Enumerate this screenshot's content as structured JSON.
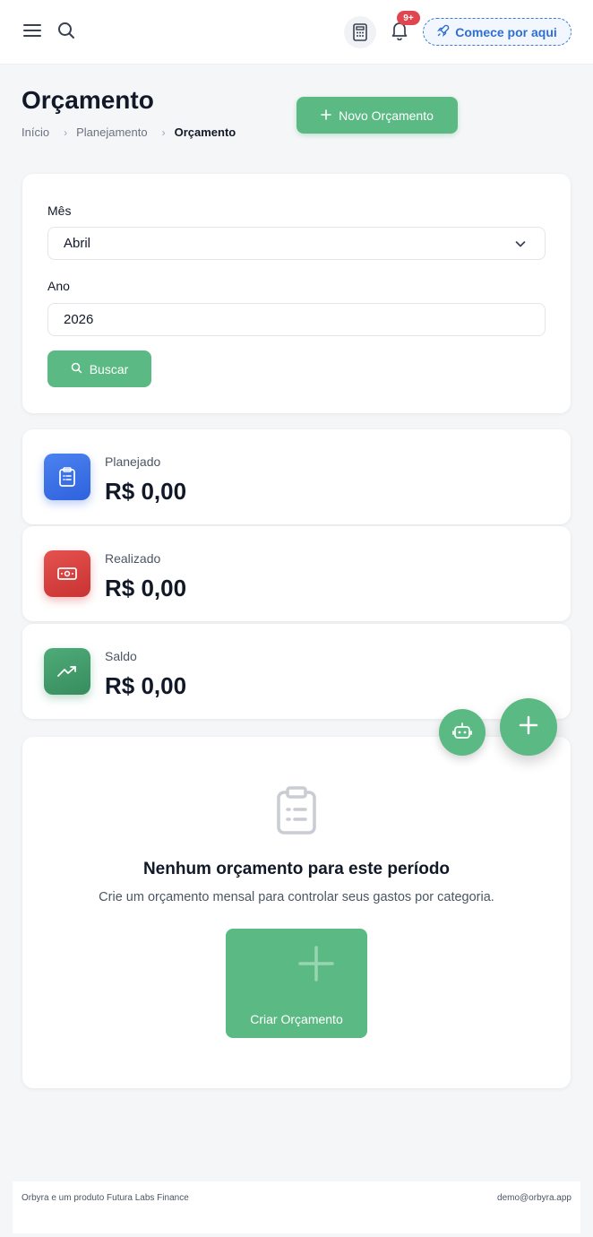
{
  "header": {
    "notification_badge": "9+",
    "start_label": "Comece por aqui"
  },
  "page": {
    "title": "Orçamento",
    "breadcrumb": [
      "Início",
      "Planejamento",
      "Orçamento"
    ],
    "new_button_label": "Novo Orçamento"
  },
  "filters": {
    "month_label": "Mês",
    "month_value": "Abril",
    "year_label": "Ano",
    "year_value": "2026",
    "search_label": "Buscar"
  },
  "stats": [
    {
      "label": "Planejado",
      "value": "R$ 0,00",
      "color": "#3b6fe6"
    },
    {
      "label": "Realizado",
      "value": "R$ 0,00",
      "color": "#dc3f3f"
    },
    {
      "label": "Saldo",
      "value": "R$ 0,00",
      "color": "#3e9b69"
    }
  ],
  "empty_state": {
    "title": "Nenhum orçamento para este período",
    "subtitle": "Crie um orçamento mensal para controlar seus gastos por categoria.",
    "create_label": "Criar Orçamento"
  },
  "footer": {
    "left": "Orbyra e um produto Futura Labs Finance",
    "right": "demo@orbyra.app"
  },
  "colors": {
    "accent_green": "#5bb983",
    "link_blue": "#2f6fcf",
    "badge_red": "#e0464f"
  }
}
